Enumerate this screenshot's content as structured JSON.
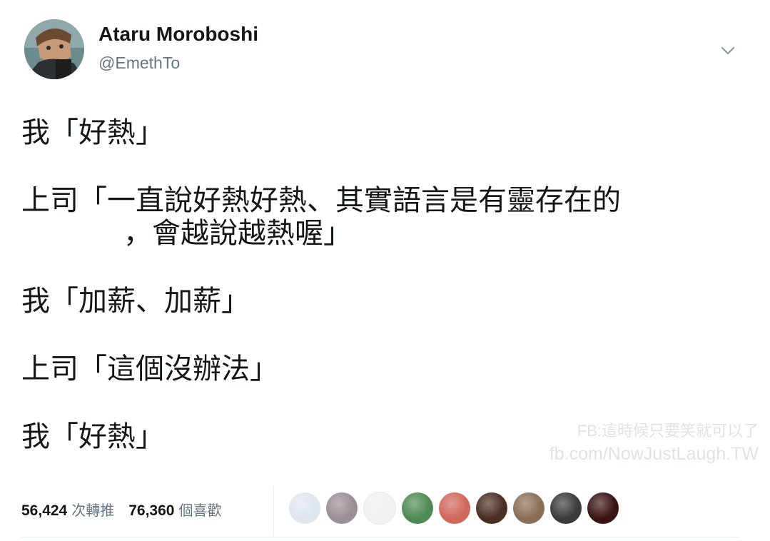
{
  "tweet": {
    "author": {
      "display_name": "Ataru Moroboshi",
      "handle": "@EmethTo"
    },
    "lines": [
      "我「好熱」",
      "上司「一直說好熱好熱、其實語言是有靈存在的",
      "，會越說越熱喔」",
      "我「加薪、加薪」",
      "上司「這個沒辦法」",
      "我「好熱」"
    ],
    "stats": {
      "retweets_count": "56,424",
      "retweets_label": "次轉推",
      "likes_count": "76,360",
      "likes_label": "個喜歡"
    },
    "liker_avatar_colors": [
      "#dfe6ee",
      "#9a8f96",
      "#f2f2f2",
      "#4f8a54",
      "#d0675b",
      "#4a2e22",
      "#8a6e56",
      "#3b3b3b",
      "#3a1414"
    ]
  },
  "watermark": {
    "line1": "FB:這時候只要笑就可以了",
    "line2": "fb.com/NowJustLaugh.TW"
  },
  "colors": {
    "text": "#14171a",
    "secondary": "#657786",
    "divider": "#e6ecf0"
  }
}
